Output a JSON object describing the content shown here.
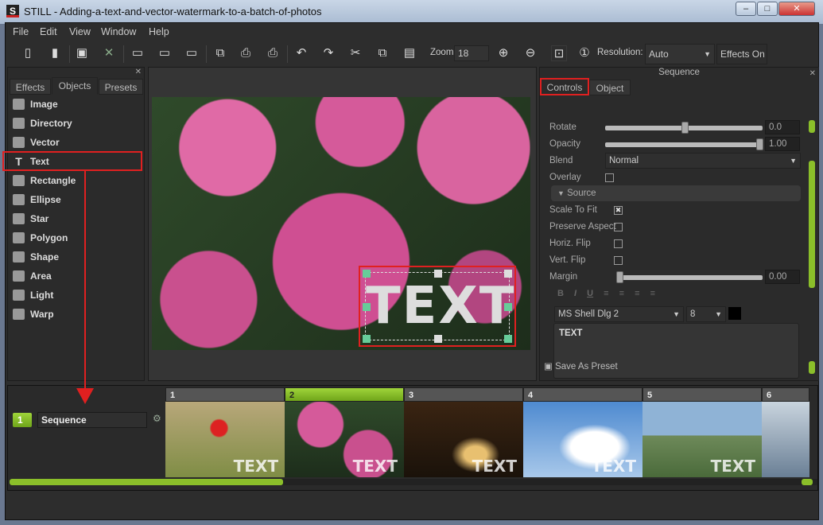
{
  "window": {
    "title": "STILL - Adding-a-text-and-vector-watermark-to-a-batch-of-photos",
    "app_icon": "S",
    "controls": [
      "minimize",
      "maximize",
      "close"
    ]
  },
  "menu": [
    "File",
    "Edit",
    "View",
    "Window",
    "Help"
  ],
  "toolbar": {
    "zoom_label": "Zoom:",
    "zoom_value": "18",
    "resolution_label": "Resolution:",
    "resolution_value": "Auto",
    "effects_label": "Effects On"
  },
  "left_panel": {
    "tabs": [
      "Effects",
      "Objects",
      "Presets"
    ],
    "active_tab": "Objects",
    "items": [
      {
        "label": "Image",
        "icon": "image-icon"
      },
      {
        "label": "Directory",
        "icon": "directory-icon"
      },
      {
        "label": "Vector",
        "icon": "svg-icon"
      },
      {
        "label": "Text",
        "icon": "text-icon",
        "selected": true
      },
      {
        "label": "Rectangle",
        "icon": "rectangle-icon"
      },
      {
        "label": "Ellipse",
        "icon": "ellipse-icon"
      },
      {
        "label": "Star",
        "icon": "star-icon"
      },
      {
        "label": "Polygon",
        "icon": "polygon-icon"
      },
      {
        "label": "Shape",
        "icon": "shape-icon"
      },
      {
        "label": "Area",
        "icon": "area-icon"
      },
      {
        "label": "Light",
        "icon": "light-icon"
      },
      {
        "label": "Warp",
        "icon": "warp-icon"
      }
    ]
  },
  "canvas": {
    "overlay_text": "TEXT"
  },
  "right_panel": {
    "header": "Sequence",
    "tabs": [
      "Controls",
      "Object"
    ],
    "active_tab": "Controls",
    "rotate": {
      "label": "Rotate",
      "value": "0.0"
    },
    "opacity": {
      "label": "Opacity",
      "value": "1.00"
    },
    "blend": {
      "label": "Blend",
      "value": "Normal"
    },
    "overlay": {
      "label": "Overlay",
      "checked": false
    },
    "source_section": "Source",
    "scale_to_fit": {
      "label": "Scale To Fit",
      "checked": true
    },
    "preserve_aspect": {
      "label": "Preserve Aspect",
      "checked": false
    },
    "horiz_flip": {
      "label": "Horiz. Flip",
      "checked": false
    },
    "vert_flip": {
      "label": "Vert. Flip",
      "checked": false
    },
    "margin": {
      "label": "Margin",
      "value": "0.00"
    },
    "format_buttons": [
      "B",
      "I",
      "U"
    ],
    "font": "MS Shell Dlg 2",
    "font_size": "8",
    "text_color": "#000000",
    "text_content": "TEXT",
    "save_preset": "Save As Preset"
  },
  "timeline": {
    "track_number": "1",
    "track_name": "Sequence",
    "frames": [
      {
        "n": "1"
      },
      {
        "n": "2",
        "active": true
      },
      {
        "n": "3"
      },
      {
        "n": "4"
      },
      {
        "n": "5"
      },
      {
        "n": "6"
      }
    ],
    "watermark": "TEXT"
  },
  "colors": {
    "accent": "#8bbf2a",
    "highlight": "#e02020"
  }
}
